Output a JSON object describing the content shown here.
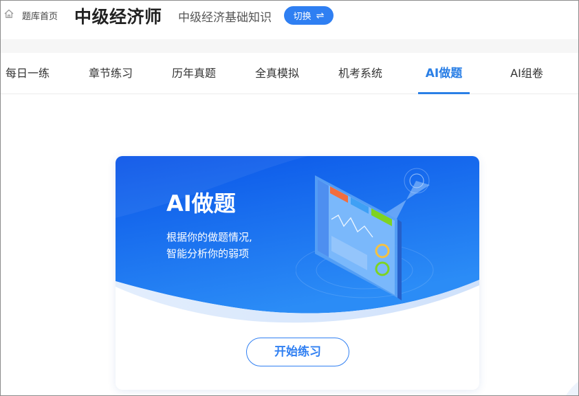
{
  "header": {
    "home_label": "题库首页",
    "exam_title": "中级经济师",
    "subject_name": "中级经济基础知识",
    "switch_label": "切换",
    "switch_icon": "⇌"
  },
  "nav": {
    "tabs": [
      {
        "label": "每日一练",
        "active": false
      },
      {
        "label": "章节练习",
        "active": false
      },
      {
        "label": "历年真题",
        "active": false
      },
      {
        "label": "全真模拟",
        "active": false
      },
      {
        "label": "机考系统",
        "active": false
      },
      {
        "label": "AI做题",
        "active": true
      },
      {
        "label": "AI组卷",
        "active": false
      }
    ]
  },
  "card": {
    "title": "AI做题",
    "description_lines": [
      "根据你的做题情况,",
      "智能分析你的弱项"
    ],
    "start_button": "开始练习"
  },
  "colors": {
    "accent": "#2f7ff2",
    "nav_active": "#2a7fe6",
    "banner_top": "#0a55e8",
    "banner_bottom": "#2b8cf6"
  }
}
